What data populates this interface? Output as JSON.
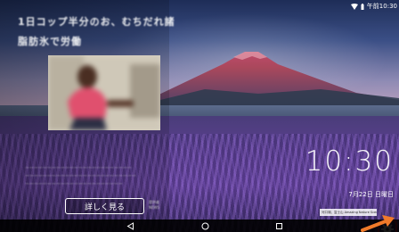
{
  "status_bar": {
    "time": "午前10:30",
    "icons": [
      "wifi-icon",
      "battery-icon"
    ]
  },
  "card": {
    "headline_lines": [
      "1日コップ半分のお、むちだれ諸",
      "脂肪氷で労働"
    ],
    "body_lines": [
      "ーーーーーーーーーーーーーーーーーーーーーーーー",
      "ーーーーーーーーーーーーーーーーーーーーーーーーー",
      "ーーーーーーーーーーーーーーーーーーーーーー"
    ],
    "detail_button_label": "詳しく見る",
    "source_lines": [
      "提供者",
      "NEWS"
    ]
  },
  "clock": {
    "time": "10:30",
    "date": "7月22日 日曜日"
  },
  "photo_credit": "河口湖、富士山 Amazing Nature Scenery",
  "nav_bar": {
    "buttons": [
      "back-icon",
      "home-icon",
      "recents-icon"
    ]
  },
  "colors": {
    "highlight_ring": "#e8243a",
    "arrow": "#f07a2a"
  }
}
